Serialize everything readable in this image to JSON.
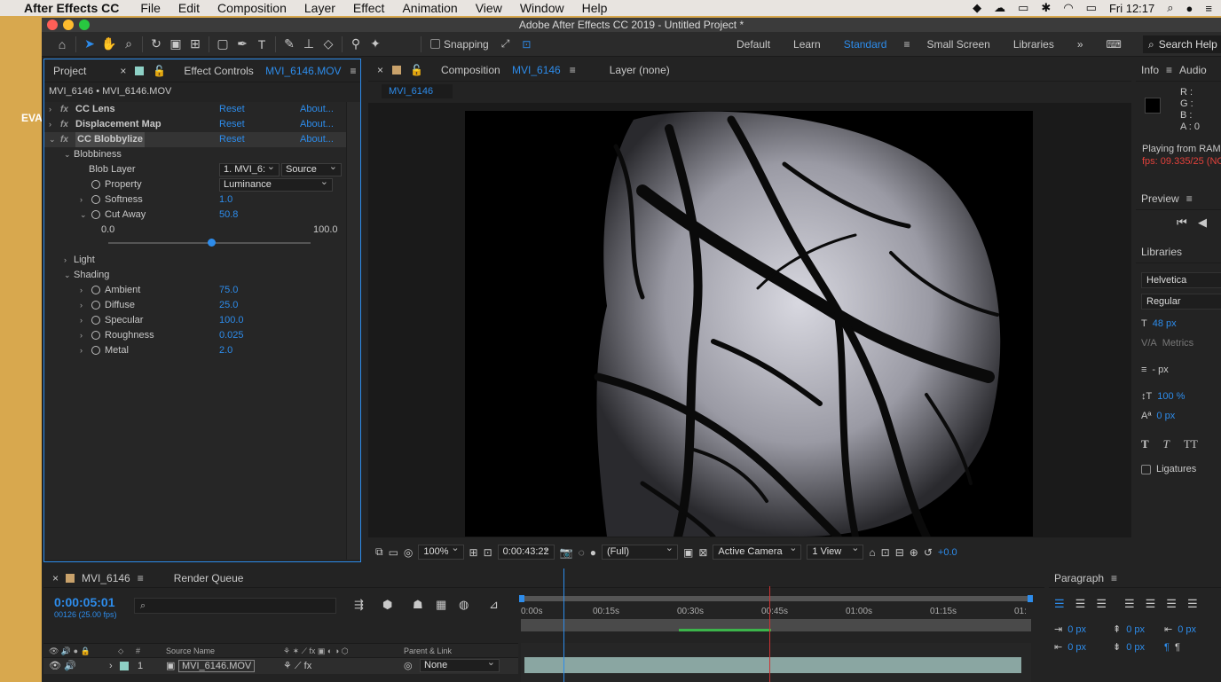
{
  "menubar": {
    "app_name": "After Effects CC",
    "items": [
      "File",
      "Edit",
      "Composition",
      "Layer",
      "Effect",
      "Animation",
      "View",
      "Window",
      "Help"
    ],
    "clock": "Fri 12:17"
  },
  "desktop_label": "EVA",
  "window": {
    "title": "Adobe After Effects CC 2019 - Untitled Project *"
  },
  "toolbar": {
    "snapping_label": "Snapping",
    "workspaces": [
      "Default",
      "Learn",
      "Standard",
      "Small Screen",
      "Libraries"
    ],
    "active_workspace": "Standard",
    "search_help": "Search Help"
  },
  "project_panel": {
    "tab": "Project"
  },
  "effect_controls": {
    "tab_prefix": "Effect Controls",
    "tab_file": "MVI_6146.MOV",
    "subtitle": "MVI_6146 • MVI_6146.MOV",
    "fx_tag": "fx",
    "reset_label": "Reset",
    "about_label": "About...",
    "effects": [
      "CC Lens",
      "Displacement Map",
      "CC Blobbylize"
    ],
    "blobbiness": {
      "label": "Blobbiness",
      "blob_layer_label": "Blob Layer",
      "blob_layer_value": "1. MVI_6:",
      "blob_layer_source": "Source",
      "property_label": "Property",
      "property_value": "Luminance",
      "softness_label": "Softness",
      "softness_value": "1.0",
      "cutaway_label": "Cut Away",
      "cutaway_value": "50.8",
      "slider_min": "0.0",
      "slider_max": "100.0",
      "slider_fraction": 0.508
    },
    "light_label": "Light",
    "shading": {
      "label": "Shading",
      "params": [
        {
          "label": "Ambient",
          "value": "75.0"
        },
        {
          "label": "Diffuse",
          "value": "25.0"
        },
        {
          "label": "Specular",
          "value": "100.0"
        },
        {
          "label": "Roughness",
          "value": "0.025"
        },
        {
          "label": "Metal",
          "value": "2.0"
        }
      ]
    }
  },
  "composition": {
    "tab_prefix": "Composition",
    "tab_name": "MVI_6146",
    "layer_tab": "Layer (none)",
    "comp_name_tab": "MVI_6146",
    "zoom": "100%",
    "timecode": "0:00:43:22",
    "resolution": "(Full)",
    "camera": "Active Camera",
    "views": "1 View",
    "exposure": "+0.0"
  },
  "info_panel": {
    "tab": "Info",
    "tab2": "Audio",
    "r": "R :",
    "g": "G :",
    "b": "B :",
    "a": "A : 0",
    "playing": "Playing from RAM",
    "fps": "fps: 09.335/25 (NOT"
  },
  "preview_panel": {
    "tab": "Preview"
  },
  "character_panel": {
    "tab": "Libraries",
    "font": "Helvetica",
    "style": "Regular",
    "size": "48 px",
    "kerning": "Metrics",
    "leading": "- px",
    "scale": "100 %",
    "baseline": "0 px",
    "ligatures": "Ligatures"
  },
  "timeline": {
    "comp_tab": "MVI_6146",
    "render_queue": "Render Queue",
    "timecode": "0:00:05:01",
    "fps": "00126 (25.00 fps)",
    "ruler_labels": [
      "0:00s",
      "00:15s",
      "00:30s",
      "00:45s",
      "01:00s",
      "01:15s",
      "01:"
    ],
    "playhead_fraction": 0.083,
    "work_area_start_fraction": 0.31,
    "work_area_end_fraction": 0.49,
    "columns": {
      "number": "#",
      "source_name": "Source Name",
      "parent": "Parent & Link"
    },
    "layer": {
      "index": "1",
      "name": "MVI_6146.MOV",
      "parent": "None"
    }
  },
  "paragraph_panel": {
    "tab": "Paragraph",
    "indent_left": "0 px",
    "indent_right": "0 px",
    "indent_first": "0 px",
    "space_before": "0 px",
    "space_after": "0 px"
  }
}
